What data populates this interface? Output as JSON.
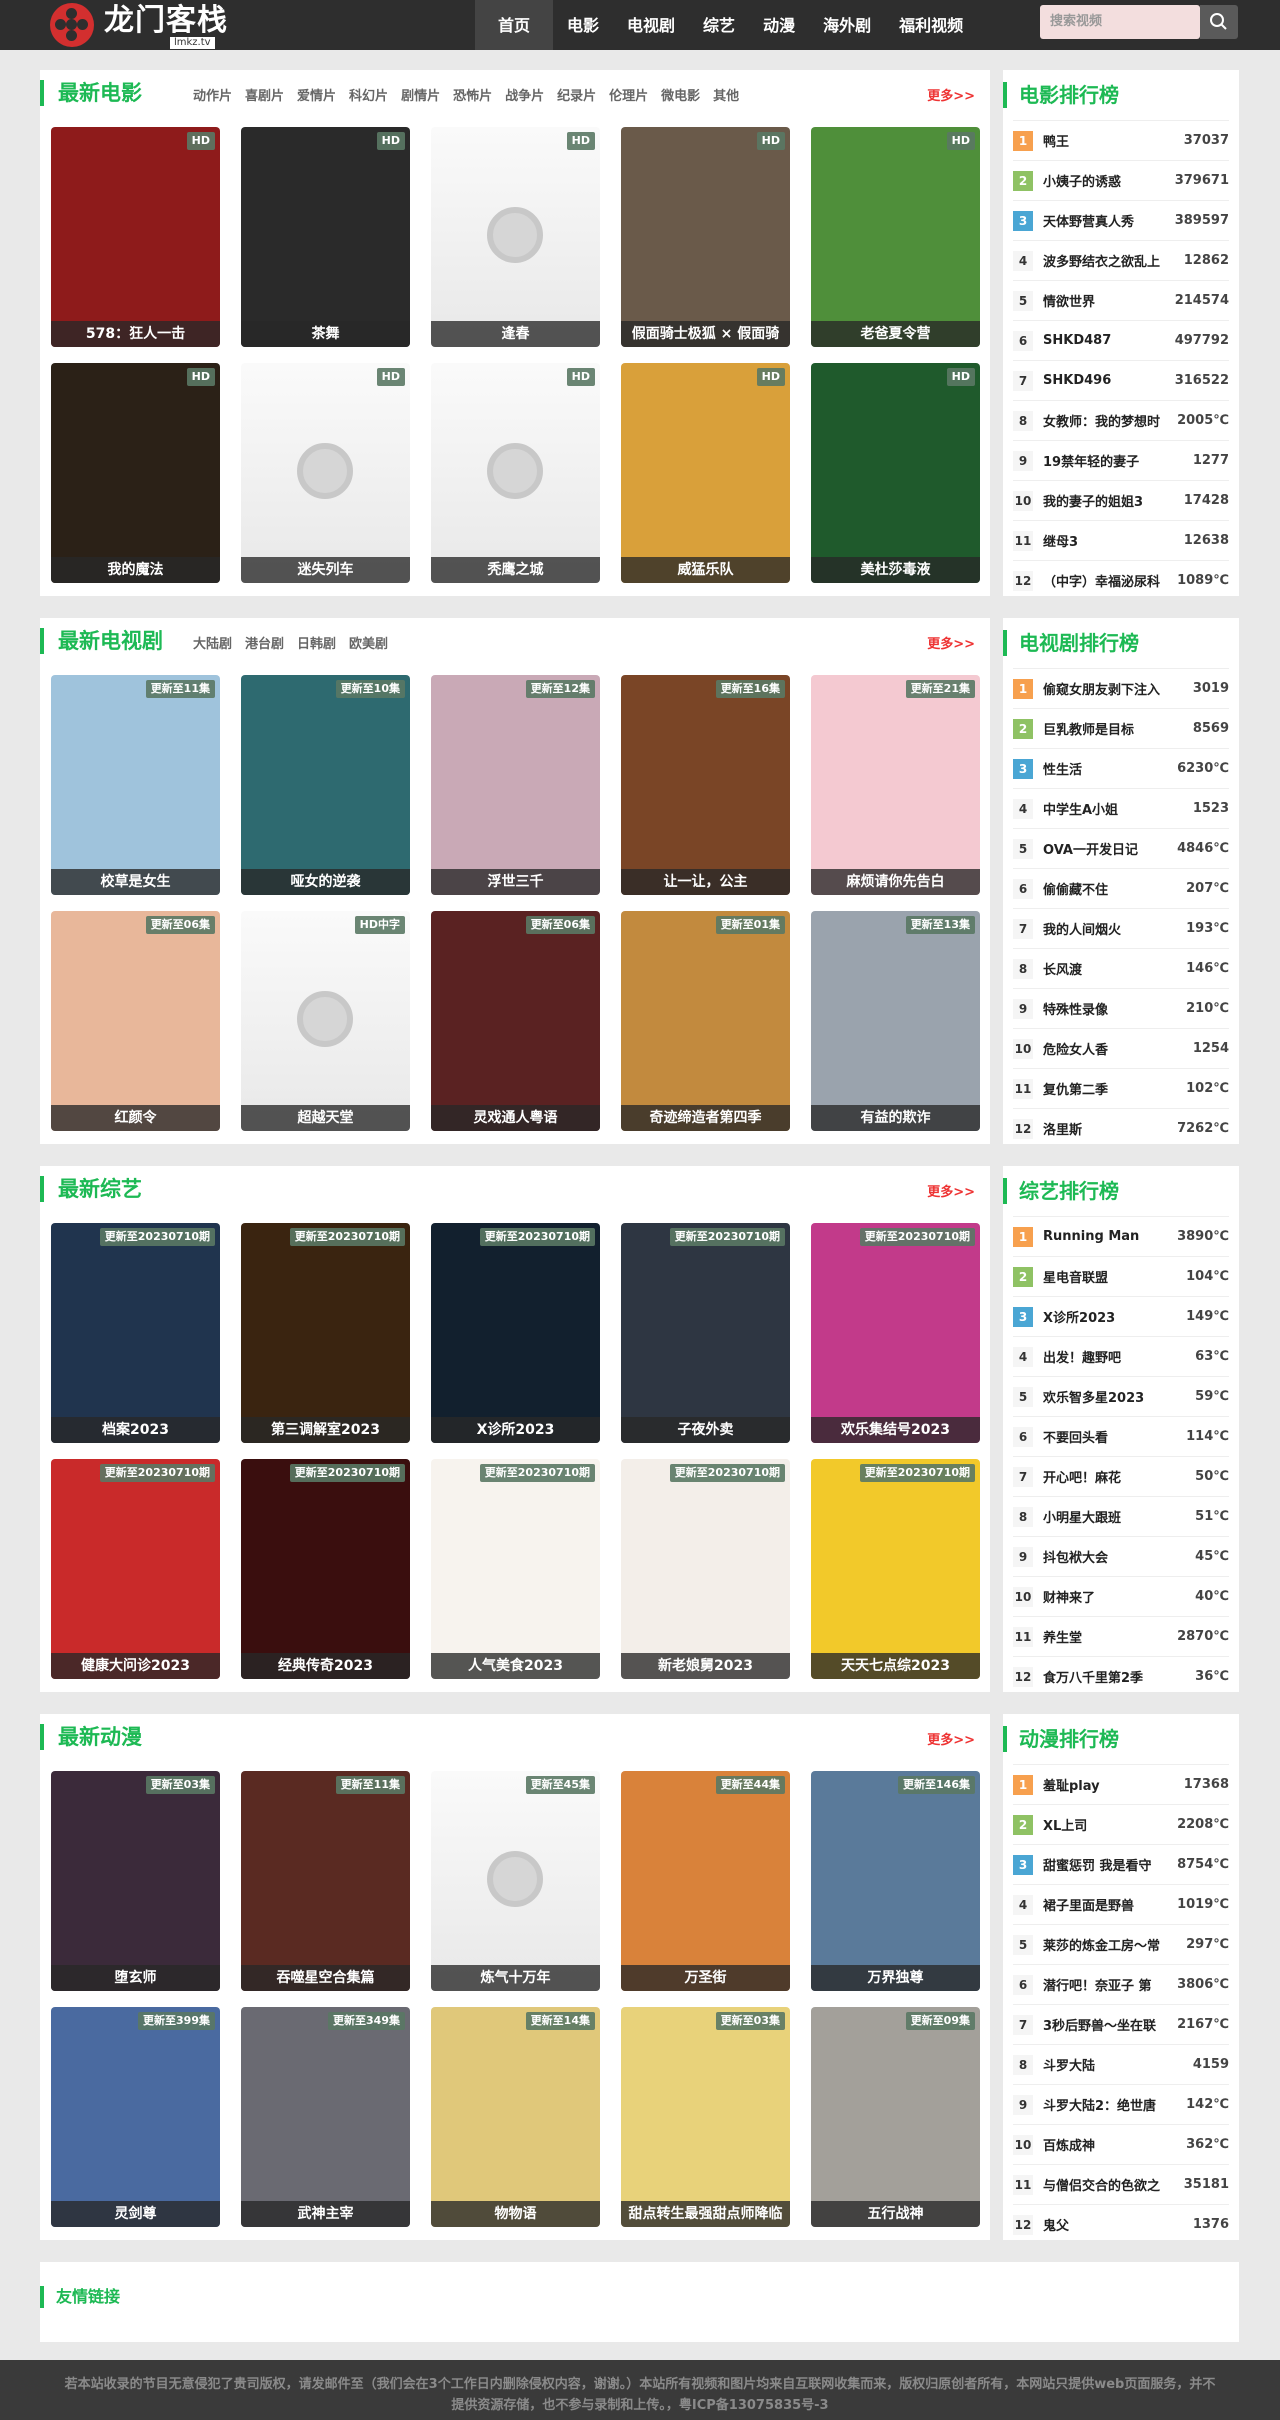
{
  "header": {
    "logo_text": "龙门客栈",
    "logo_sub": "lmkz.tv",
    "nav": [
      "首页",
      "电影",
      "电视剧",
      "综艺",
      "动漫",
      "海外剧",
      "福利视频"
    ],
    "search_placeholder": "搜索视频"
  },
  "sections": [
    {
      "title": "最新电影",
      "categories": [
        "动作片",
        "喜剧片",
        "爱情片",
        "科幻片",
        "剧情片",
        "恐怖片",
        "战争片",
        "纪录片",
        "伦理片",
        "微电影",
        "其他"
      ],
      "more": "更多>>",
      "items": [
        {
          "title": "578：狂人一击",
          "badge": "HD",
          "color": "#8e1b1b"
        },
        {
          "title": "茶舞",
          "badge": "HD",
          "color": "#2a2a2a"
        },
        {
          "title": "逢春",
          "badge": "HD",
          "color": ""
        },
        {
          "title": "假面骑士极狐 × 假面骑",
          "badge": "HD",
          "color": "#6a5a4a"
        },
        {
          "title": "老爸夏令营",
          "badge": "HD",
          "color": "#4f8f3a"
        },
        {
          "title": "我的魔法",
          "badge": "HD",
          "color": "#2b2117"
        },
        {
          "title": "迷失列车",
          "badge": "HD",
          "color": ""
        },
        {
          "title": "秃鹰之城",
          "badge": "HD",
          "color": ""
        },
        {
          "title": "威猛乐队",
          "badge": "HD",
          "color": "#d9a03a"
        },
        {
          "title": "美杜莎毒液",
          "badge": "HD",
          "color": "#1f5a2c"
        }
      ]
    },
    {
      "title": "最新电视剧",
      "categories": [
        "大陆剧",
        "港台剧",
        "日韩剧",
        "欧美剧"
      ],
      "more": "更多>>",
      "items": [
        {
          "title": "校草是女生",
          "badge": "更新至11集",
          "color": "#9fc3dc"
        },
        {
          "title": "哑女的逆袭",
          "badge": "更新至10集",
          "color": "#2e6a70"
        },
        {
          "title": "浮世三千",
          "badge": "更新至12集",
          "color": "#c9a9b6"
        },
        {
          "title": "让一让，公主",
          "badge": "更新至16集",
          "color": "#7a4526"
        },
        {
          "title": "麻烦请你先告白",
          "badge": "更新至21集",
          "color": "#f4c9d1"
        },
        {
          "title": "红颜令",
          "badge": "更新至06集",
          "color": "#e8b79a"
        },
        {
          "title": "超越天堂",
          "badge": "HD中字",
          "color": ""
        },
        {
          "title": "灵戏通人粤语",
          "badge": "更新至06集",
          "color": "#5a2222"
        },
        {
          "title": "奇迹缔造者第四季",
          "badge": "更新至01集",
          "color": "#c28a3e"
        },
        {
          "title": "有益的欺诈",
          "badge": "更新至13集",
          "color": "#9aa3ad"
        }
      ]
    },
    {
      "title": "最新综艺",
      "categories": [],
      "more": "更多>>",
      "items": [
        {
          "title": "档案2023",
          "badge": "更新至20230710期",
          "color": "#20344e"
        },
        {
          "title": "第三调解室2023",
          "badge": "更新至20230710期",
          "color": "#3a2410"
        },
        {
          "title": "X诊所2023",
          "badge": "更新至20230710期",
          "color": "#12202e"
        },
        {
          "title": "子夜外卖",
          "badge": "更新至20230710期",
          "color": "#2e3642"
        },
        {
          "title": "欢乐集结号2023",
          "badge": "更新至20230710期",
          "color": "#c23a8a"
        },
        {
          "title": "健康大问诊2023",
          "badge": "更新至20230710期",
          "color": "#c92a2a"
        },
        {
          "title": "经典传奇2023",
          "badge": "更新至20230710期",
          "color": "#3a0e0e"
        },
        {
          "title": "人气美食2023",
          "badge": "更新至20230710期",
          "color": "#f7f3ee"
        },
        {
          "title": "新老娘舅2023",
          "badge": "更新至20230710期",
          "color": "#f3eee9"
        },
        {
          "title": "天天七点综2023",
          "badge": "更新至20230710期",
          "color": "#f2c92a"
        }
      ]
    },
    {
      "title": "最新动漫",
      "categories": [],
      "more": "更多>>",
      "items": [
        {
          "title": "堕玄师",
          "badge": "更新至03集",
          "color": "#3b2a3a"
        },
        {
          "title": "吞噬星空合集篇",
          "badge": "更新至11集",
          "color": "#5a2a22"
        },
        {
          "title": "炼气十万年",
          "badge": "更新至45集",
          "color": ""
        },
        {
          "title": "万圣街",
          "badge": "更新至44集",
          "color": "#d9823a"
        },
        {
          "title": "万界独尊",
          "badge": "更新至146集",
          "color": "#5a7a9a"
        },
        {
          "title": "灵剑尊",
          "badge": "更新至399集",
          "color": "#4a6aa0"
        },
        {
          "title": "武神主宰",
          "badge": "更新至349集",
          "color": "#6a6a72"
        },
        {
          "title": "物物语",
          "badge": "更新至14集",
          "color": "#e0c87a"
        },
        {
          "title": "甜点转生最强甜点师降临",
          "badge": "更新至03集",
          "color": "#e8d27a"
        },
        {
          "title": "五行战神",
          "badge": "更新至09集",
          "color": "#a3a09a"
        }
      ]
    }
  ],
  "rankings": [
    {
      "title": "电影排行榜",
      "items": [
        [
          "鸭王",
          "37037"
        ],
        [
          "小姨子的诱惑",
          "379671"
        ],
        [
          "天体野营真人秀",
          "389597"
        ],
        [
          "波多野结衣之欲乱上",
          "12862"
        ],
        [
          "情欲世界",
          "214574"
        ],
        [
          "SHKD487",
          "497792"
        ],
        [
          "SHKD496",
          "316522"
        ],
        [
          "女教师：我的梦想时",
          "2005℃"
        ],
        [
          "19禁年轻的妻子",
          "1277"
        ],
        [
          "我的妻子的姐姐3",
          "17428"
        ],
        [
          "继母3",
          "12638"
        ],
        [
          "（中字）幸福泌尿科",
          "1089℃"
        ]
      ]
    },
    {
      "title": "电视剧排行榜",
      "items": [
        [
          "偷窥女朋友剥下注入",
          "3019"
        ],
        [
          "巨乳教师是目标",
          "8569"
        ],
        [
          "性生活",
          "6230℃"
        ],
        [
          "中学生A小姐",
          "1523"
        ],
        [
          "OVA一开发日记",
          "4846℃"
        ],
        [
          "偷偷藏不住",
          "207℃"
        ],
        [
          "我的人间烟火",
          "193℃"
        ],
        [
          "长风渡",
          "146℃"
        ],
        [
          "特殊性录像",
          "210℃"
        ],
        [
          "危险女人香",
          "1254"
        ],
        [
          "复仇第二季",
          "102℃"
        ],
        [
          "洛里斯",
          "7262℃"
        ]
      ]
    },
    {
      "title": "综艺排行榜",
      "items": [
        [
          "Running Man",
          "3890℃"
        ],
        [
          "星电音联盟",
          "104℃"
        ],
        [
          "X诊所2023",
          "149℃"
        ],
        [
          "出发！趣野吧",
          "63℃"
        ],
        [
          "欢乐智多星2023",
          "59℃"
        ],
        [
          "不要回头看",
          "114℃"
        ],
        [
          "开心吧！麻花",
          "50℃"
        ],
        [
          "小明星大跟班",
          "51℃"
        ],
        [
          "抖包袱大会",
          "45℃"
        ],
        [
          "财神来了",
          "40℃"
        ],
        [
          "养生堂",
          "2870℃"
        ],
        [
          "食万八千里第2季",
          "36℃"
        ]
      ]
    },
    {
      "title": "动漫排行榜",
      "items": [
        [
          "羞耻play",
          "17368"
        ],
        [
          "XL上司",
          "2208℃"
        ],
        [
          "甜蜜惩罚 我是看守",
          "8754℃"
        ],
        [
          "裙子里面是野兽",
          "1019℃"
        ],
        [
          "莱莎的炼金工房～常",
          "297℃"
        ],
        [
          "潜行吧！奈亚子 第",
          "3806℃"
        ],
        [
          "3秒后野兽～坐在联",
          "2167℃"
        ],
        [
          "斗罗大陆",
          "4159"
        ],
        [
          "斗罗大陆2：绝世唐",
          "142℃"
        ],
        [
          "百炼成神",
          "362℃"
        ],
        [
          "与僧侣交合的色欲之",
          "35181"
        ],
        [
          "鬼父",
          "1376"
        ]
      ]
    }
  ],
  "links_title": "友情链接",
  "footer": "若本站收录的节目无意侵犯了贵司版权，请发邮件至（我们会在3个工作日内删除侵权内容，谢谢。）本站所有视频和图片均来自互联网收集而来，版权归原创者所有，本网站只提供web页面服务，并不提供资源存储，也不参与录制和上传。，粤ICP备13075835号-3"
}
